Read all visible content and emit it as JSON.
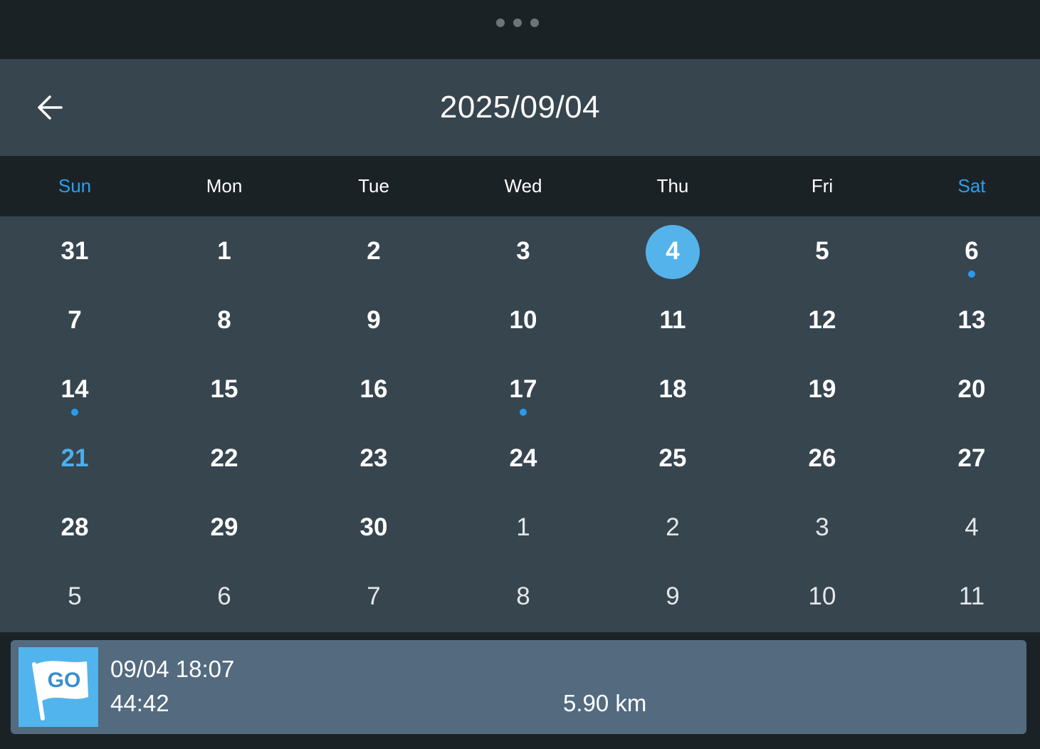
{
  "app": {
    "menu_icon": "more-dots-icon"
  },
  "header": {
    "back_icon": "arrow-left-icon",
    "title": "2025/09/04"
  },
  "weekdays": [
    "Sun",
    "Mon",
    "Tue",
    "Wed",
    "Thu",
    "Fri",
    "Sat"
  ],
  "calendar": {
    "rows": [
      [
        {
          "day": "31",
          "in_month": true
        },
        {
          "day": "1",
          "in_month": true
        },
        {
          "day": "2",
          "in_month": true
        },
        {
          "day": "3",
          "in_month": true
        },
        {
          "day": "4",
          "in_month": true,
          "selected": true
        },
        {
          "day": "5",
          "in_month": true
        },
        {
          "day": "6",
          "in_month": true,
          "has_activity": true
        }
      ],
      [
        {
          "day": "7",
          "in_month": true
        },
        {
          "day": "8",
          "in_month": true
        },
        {
          "day": "9",
          "in_month": true
        },
        {
          "day": "10",
          "in_month": true
        },
        {
          "day": "11",
          "in_month": true
        },
        {
          "day": "12",
          "in_month": true
        },
        {
          "day": "13",
          "in_month": true
        }
      ],
      [
        {
          "day": "14",
          "in_month": true,
          "has_activity": true
        },
        {
          "day": "15",
          "in_month": true
        },
        {
          "day": "16",
          "in_month": true
        },
        {
          "day": "17",
          "in_month": true,
          "has_activity": true
        },
        {
          "day": "18",
          "in_month": true
        },
        {
          "day": "19",
          "in_month": true
        },
        {
          "day": "20",
          "in_month": true
        }
      ],
      [
        {
          "day": "21",
          "in_month": true,
          "highlight": true
        },
        {
          "day": "22",
          "in_month": true
        },
        {
          "day": "23",
          "in_month": true
        },
        {
          "day": "24",
          "in_month": true
        },
        {
          "day": "25",
          "in_month": true
        },
        {
          "day": "26",
          "in_month": true
        },
        {
          "day": "27",
          "in_month": true
        }
      ],
      [
        {
          "day": "28",
          "in_month": true
        },
        {
          "day": "29",
          "in_month": true
        },
        {
          "day": "30",
          "in_month": true
        },
        {
          "day": "1",
          "in_month": false
        },
        {
          "day": "2",
          "in_month": false
        },
        {
          "day": "3",
          "in_month": false
        },
        {
          "day": "4",
          "in_month": false
        }
      ],
      [
        {
          "day": "5",
          "in_month": false
        },
        {
          "day": "6",
          "in_month": false
        },
        {
          "day": "7",
          "in_month": false
        },
        {
          "day": "8",
          "in_month": false
        },
        {
          "day": "9",
          "in_month": false
        },
        {
          "day": "10",
          "in_month": false
        },
        {
          "day": "11",
          "in_month": false
        }
      ]
    ]
  },
  "activity": {
    "icon": "go-flag-icon",
    "icon_text": "GO",
    "datetime": "09/04 18:07",
    "duration": "44:42",
    "distance": "5.90 km"
  },
  "colors": {
    "accent": "#2aa0f0",
    "selected": "#55b3ec",
    "activity_dot": "#2a9aee",
    "header_bg": "#37454f",
    "card_bg": "#536a7f"
  }
}
